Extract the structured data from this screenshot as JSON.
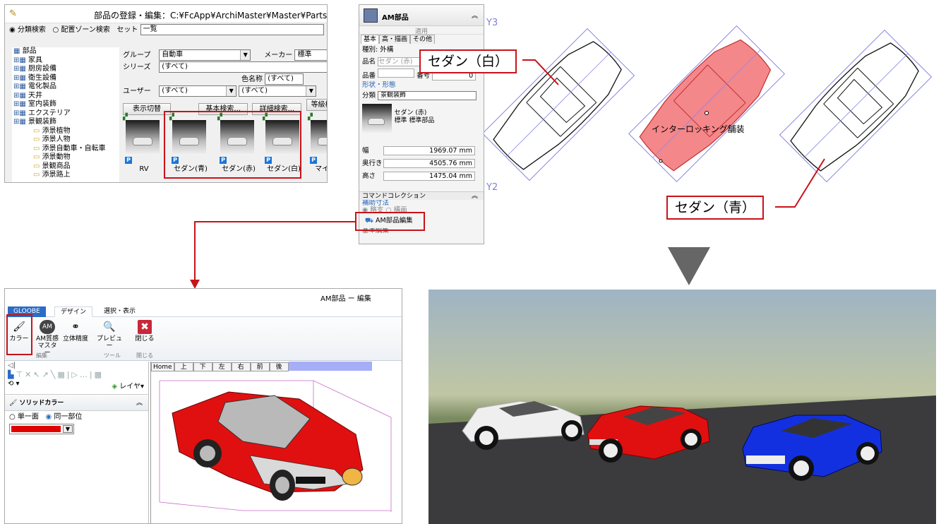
{
  "parts_dialog": {
    "title": "部品の登録・編集：C:¥FcApp¥ArchiMaster¥Master¥Parts¥FC",
    "search_mode": {
      "category": "分類検索",
      "zone": "配置ゾーン検索"
    },
    "set_label": "セット",
    "set_value": "一覧",
    "tree": [
      {
        "label": "部品",
        "level": 0
      },
      {
        "label": "家具",
        "level": 1
      },
      {
        "label": "厨房設備",
        "level": 1
      },
      {
        "label": "衛生設備",
        "level": 1
      },
      {
        "label": "電化製品",
        "level": 1
      },
      {
        "label": "天井",
        "level": 1
      },
      {
        "label": "室内装飾",
        "level": 1
      },
      {
        "label": "エクステリア",
        "level": 1
      },
      {
        "label": "景観装飾",
        "level": 1
      },
      {
        "label": "添景植物",
        "level": 2
      },
      {
        "label": "添景人物",
        "level": 2
      },
      {
        "label": "添景自動車・自転車",
        "level": 2
      },
      {
        "label": "添景動物",
        "level": 2
      },
      {
        "label": "景観商品",
        "level": 2
      },
      {
        "label": "添景路上",
        "level": 2
      }
    ],
    "group_label": "グループ",
    "group_value": "自動車",
    "maker_label": "メーカー",
    "maker_value": "標準",
    "series_label": "シリーズ",
    "series_value": "(すべて)",
    "color_label": "色名称",
    "color_value": "(すべて)",
    "user_label": "ユーザー",
    "user_value": "(すべて)",
    "user_value2": "(すべて)",
    "buttons": {
      "display": "表示切替",
      "basic": "基本検索...",
      "detail": "詳細検索...",
      "grade": "等級検"
    },
    "tiles": [
      "RV",
      "セダン(青)",
      "セダン(赤)",
      "セダン(白)",
      "マイクロ"
    ],
    "p_badge": "P"
  },
  "props_panel": {
    "title": "AM部品",
    "apply": "適用",
    "tabs": [
      "基本",
      "高・描画",
      "その他"
    ],
    "type_label": "種別:",
    "type_value": "外構",
    "name_label": "品名",
    "name_value": "セダン (赤)",
    "number_label": "品番",
    "code_label": "番号",
    "code_value": "0",
    "shape_section": "形状・形態",
    "class_label": "分類",
    "class_value": "景観装飾",
    "preview_line1": "セダン (赤)",
    "preview_line2": "標準 標準部品",
    "width_label": "幅",
    "width_value": "1969.07",
    "depth_label": "奥行き",
    "depth_value": "4505.76",
    "height_label": "高さ",
    "height_value": "1475.04",
    "unit": "mm",
    "cmd_section": "コマンドコレクション",
    "aux_label": "補助寸法",
    "radio_a": "略支",
    "radio_b": "構画",
    "edit_button": "AM部品編集",
    "cut_item": "基本編集"
  },
  "plan_view": {
    "axis_y3": "Y3",
    "axis_y2": "Y2",
    "label_white": "セダン（白）",
    "label_blue": "セダン（青）",
    "paving": "インターロッキング舗装"
  },
  "editor": {
    "title": "AM部品 ー 編集",
    "tabs": [
      "GLOOBE",
      "デザイン",
      "選択・表示"
    ],
    "ribbon": [
      {
        "label": "カラー",
        "icon": "color-brush-icon"
      },
      {
        "label": "AM質感マスター",
        "icon": "texture-master-icon"
      },
      {
        "label": "立体精度",
        "icon": "solid-precision-icon"
      },
      {
        "label": "プレビュー",
        "icon": "preview-icon"
      },
      {
        "label": "閉じる",
        "icon": "close-icon"
      }
    ],
    "groups": [
      "編集",
      "ツール",
      "閉じる"
    ],
    "view_tabs": [
      "Home",
      "上",
      "下",
      "左",
      "右",
      "前",
      "後"
    ],
    "layer_label": "レイヤ",
    "solid_color_title": "ソリッドカラー",
    "radio_single": "単一面",
    "radio_same": "同一部位",
    "swatch_color": "#e00000"
  },
  "colors": {
    "accent_red": "#c8131a",
    "car_red": "#e01010",
    "car_blue": "#1330e0",
    "blue_tab": "#2b6cc4"
  }
}
